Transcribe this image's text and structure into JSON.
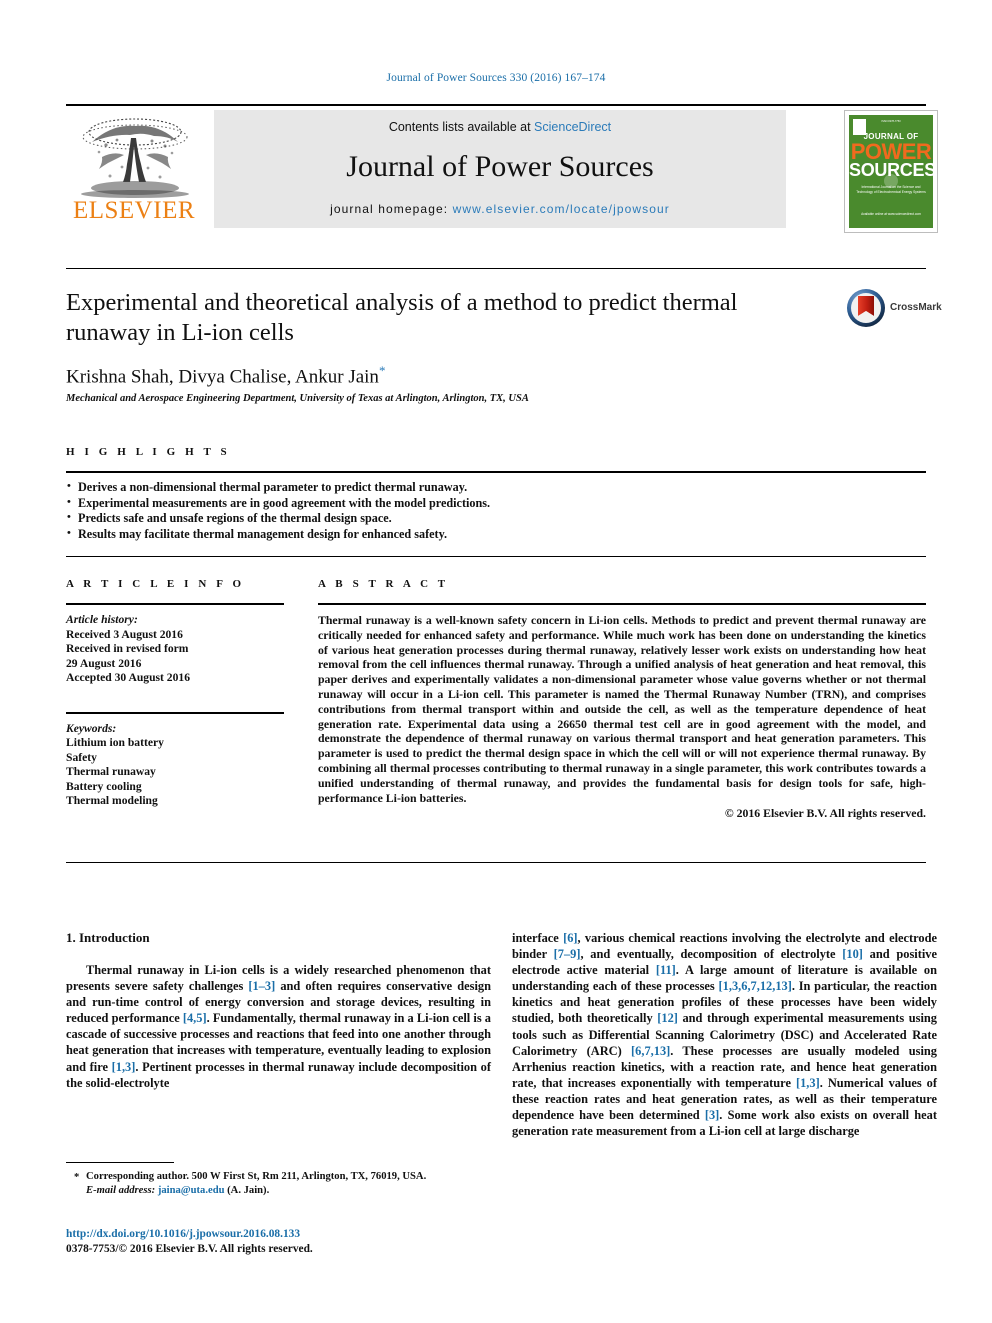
{
  "running_head": "Journal of Power Sources 330 (2016) 167–174",
  "masthead": {
    "publisher_name": "ELSEVIER",
    "contents_prefix": "Contents lists available at",
    "contents_link": "ScienceDirect",
    "journal_name": "Journal of Power Sources",
    "homepage_prefix": "journal homepage:",
    "homepage_link": "www.elsevier.com/locate/jpowsour",
    "cover": {
      "top_tag": "ISSN 0378-7753",
      "line1": "JOURNAL OF",
      "line2": "POWER",
      "line3": "SOURCES",
      "subtitle": "International Journal on the Science and Technology of Electrochemical Energy Systems",
      "footer": "Available online at\nwww.sciencedirect.com"
    },
    "accent_orange": "#ec8014",
    "link_blue": "#2b7bb9",
    "cover_green": "#4a8a2d"
  },
  "article": {
    "title": "Experimental and theoretical analysis of a method to predict thermal runaway in Li-ion cells",
    "authors": "Krishna Shah, Divya Chalise, Ankur Jain",
    "corresponding_marker": "*",
    "affiliation": "Mechanical and Aerospace Engineering Department, University of Texas at Arlington, Arlington, TX, USA",
    "crossmark_label": "CrossMark"
  },
  "highlights": {
    "heading": "H I G H L I G H T S",
    "items": [
      "Derives a non-dimensional thermal parameter to predict thermal runaway.",
      "Experimental measurements are in good agreement with the model predictions.",
      "Predicts safe and unsafe regions of the thermal design space.",
      "Results may facilitate thermal management design for enhanced safety."
    ]
  },
  "article_info": {
    "heading": "A R T I C L E   I N F O",
    "history_label": "Article history:",
    "history": [
      "Received 3 August 2016",
      "Received in revised form",
      "29 August 2016",
      "Accepted 30 August 2016"
    ],
    "keywords_label": "Keywords:",
    "keywords": [
      "Lithium ion battery",
      "Safety",
      "Thermal runaway",
      "Battery cooling",
      "Thermal modeling"
    ]
  },
  "abstract": {
    "heading": "A B S T R A C T",
    "text": "Thermal runaway is a well-known safety concern in Li-ion cells. Methods to predict and prevent thermal runaway are critically needed for enhanced safety and performance. While much work has been done on understanding the kinetics of various heat generation processes during thermal runaway, relatively lesser work exists on understanding how heat removal from the cell influences thermal runaway. Through a unified analysis of heat generation and heat removal, this paper derives and experimentally validates a non-dimensional parameter whose value governs whether or not thermal runaway will occur in a Li-ion cell. This parameter is named the Thermal Runaway Number (TRN), and comprises contributions from thermal transport within and outside the cell, as well as the temperature dependence of heat generation rate. Experimental data using a 26650 thermal test cell are in good agreement with the model, and demonstrate the dependence of thermal runaway on various thermal transport and heat generation parameters. This parameter is used to predict the thermal design space in which the cell will or will not experience thermal runaway. By combining all thermal processes contributing to thermal runaway in a single parameter, this work contributes towards a unified understanding of thermal runaway, and provides the fundamental basis for design tools for safe, high-performance Li-ion batteries.",
    "copyright": "© 2016 Elsevier B.V. All rights reserved."
  },
  "body": {
    "section_heading": "1. Introduction",
    "left_paragraph_parts": [
      "Thermal runaway in Li-ion cells is a widely researched phenomenon that presents severe safety challenges ",
      "[1–3]",
      " and often requires conservative design and run-time control of energy conversion and storage devices, resulting in reduced performance ",
      "[4,5]",
      ". Fundamentally, thermal runaway in a Li-ion cell is a cascade of successive processes and reactions that feed into one another through heat generation that increases with temperature, eventually leading to explosion and fire ",
      "[1,3]",
      ". Pertinent processes in thermal runaway include decomposition of the solid-electrolyte"
    ],
    "right_paragraph_parts": [
      "interface ",
      "[6]",
      ", various chemical reactions involving the electrolyte and electrode binder ",
      "[7–9]",
      ", and eventually, decomposition of electrolyte ",
      "[10]",
      " and positive electrode active material ",
      "[11]",
      ". A large amount of literature is available on understanding each of these processes ",
      "[1,3,6,7,12,13]",
      ". In particular, the reaction kinetics and heat generation profiles of these processes have been widely studied, both theoretically ",
      "[12]",
      " and through experimental measurements using tools such as Differential Scanning Calorimetry (DSC) and Accelerated Rate Calorimetry (ARC) ",
      "[6,7,13]",
      ". These processes are usually modeled using Arrhenius reaction kinetics, with a reaction rate, and hence heat generation rate, that increases exponentially with temperature ",
      "[1,3]",
      ". Numerical values of these reaction rates and heat generation rates, as well as their temperature dependence have been determined ",
      "[3]",
      ". Some work also exists on overall heat generation rate measurement from a Li-ion cell at large discharge"
    ]
  },
  "footer": {
    "corresponding_star": "*",
    "corresponding_text": "Corresponding author. 500 W First St, Rm 211, Arlington, TX, 76019, USA.",
    "email_label": "E-mail address:",
    "email": "jaina@uta.edu",
    "email_suffix": "(A. Jain).",
    "doi": "http://dx.doi.org/10.1016/j.jpowsour.2016.08.133",
    "issn_line": "0378-7753/© 2016 Elsevier B.V. All rights reserved."
  }
}
